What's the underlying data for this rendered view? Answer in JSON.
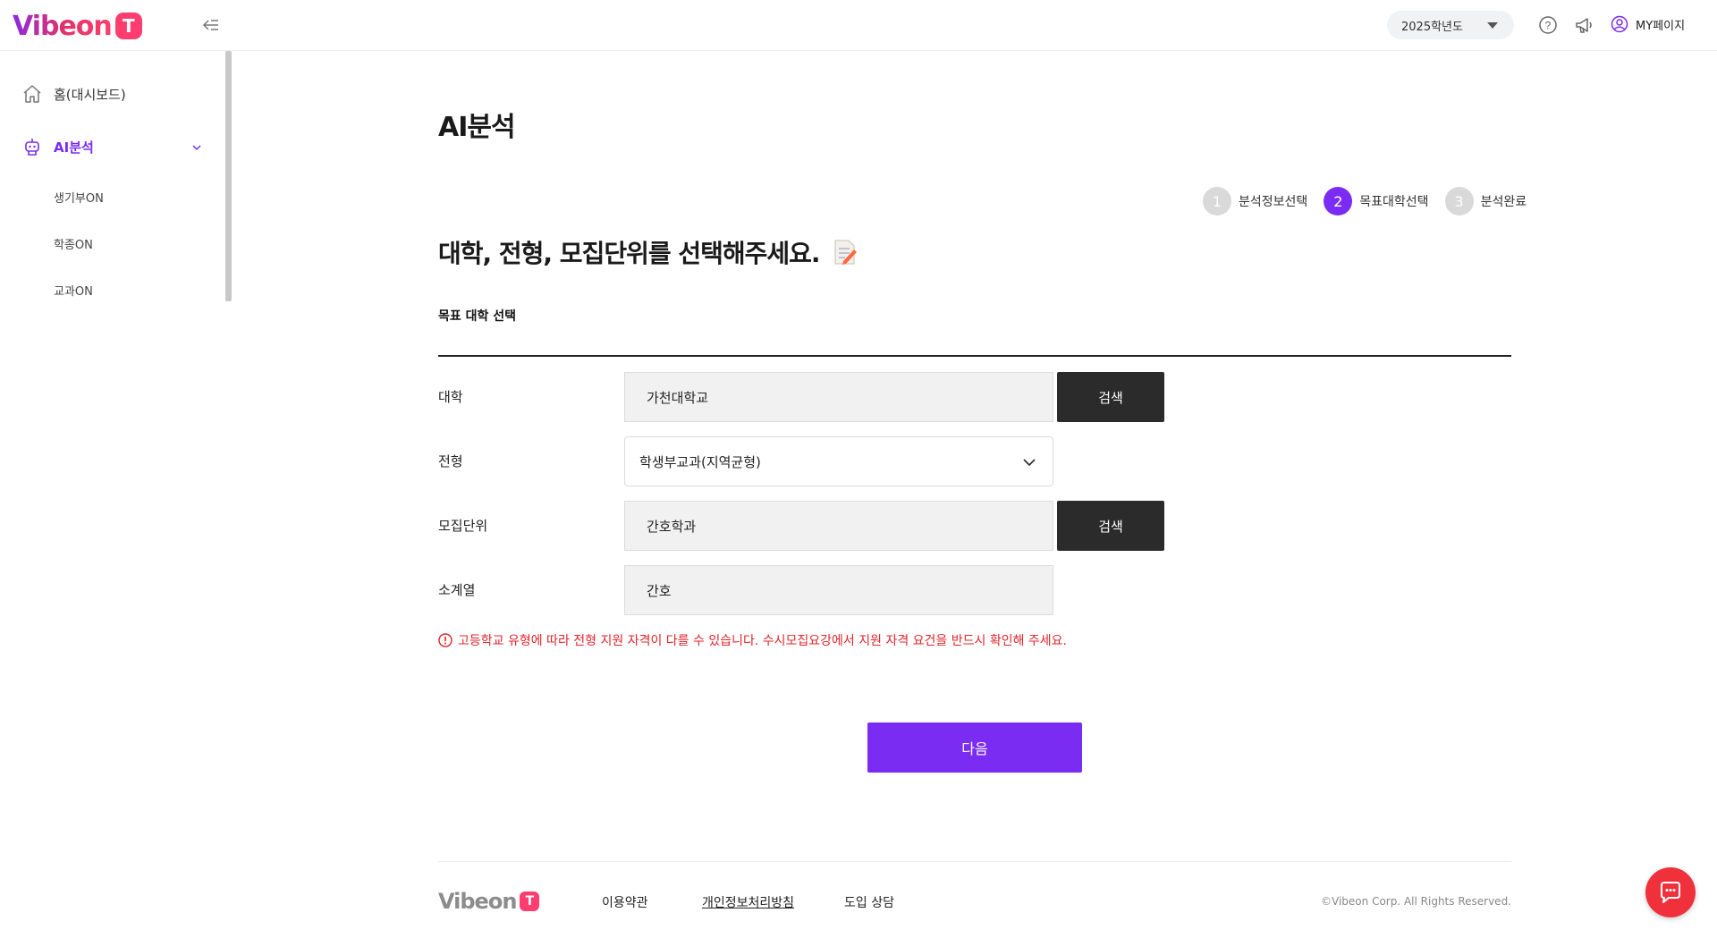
{
  "header": {
    "logo_text": "Vibeon",
    "logo_badge": "T",
    "year_select": "2025학년도",
    "mypage_label": "MY페이지"
  },
  "sidebar": {
    "items": [
      {
        "label": "홈(대시보드)",
        "icon": "home-icon"
      },
      {
        "label": "AI분석",
        "icon": "robot-icon",
        "active": true
      }
    ],
    "sub_items": [
      "생기부ON",
      "학종ON",
      "교과ON"
    ]
  },
  "main": {
    "page_title": "AI분석",
    "steps": [
      {
        "num": "1",
        "label": "분석정보선택"
      },
      {
        "num": "2",
        "label": "목표대학선택",
        "current": true
      },
      {
        "num": "3",
        "label": "분석완료"
      }
    ],
    "headline": "대학, 전형, 모집단위를 선택해주세요.",
    "section_title": "목표 대학 선택",
    "form": {
      "university": {
        "label": "대학",
        "value": "가천대학교",
        "button": "검색"
      },
      "admission_type": {
        "label": "전형",
        "value": "학생부교과(지역균형)"
      },
      "recruit_unit": {
        "label": "모집단위",
        "value": "간호학과",
        "button": "검색"
      },
      "sub_field": {
        "label": "소계열",
        "value": "간호"
      }
    },
    "notice": "고등학교 유형에 따라 전형 지원 자격이 다를 수 있습니다. 수시모집요강에서 지원 자격 요건을 반드시 확인해 주세요.",
    "next_button": "다음"
  },
  "footer": {
    "logo_text": "Vibeon",
    "logo_badge": "T",
    "links": [
      "이용약관",
      "개인정보처리방침",
      "도입 상담"
    ],
    "copyright": "©Vibeon Corp. All Rights Reserved."
  },
  "colors": {
    "accent": "#7a2cf2",
    "danger": "#e0242b",
    "dark_button": "#2b2b2b",
    "chat": "#f0313b"
  }
}
